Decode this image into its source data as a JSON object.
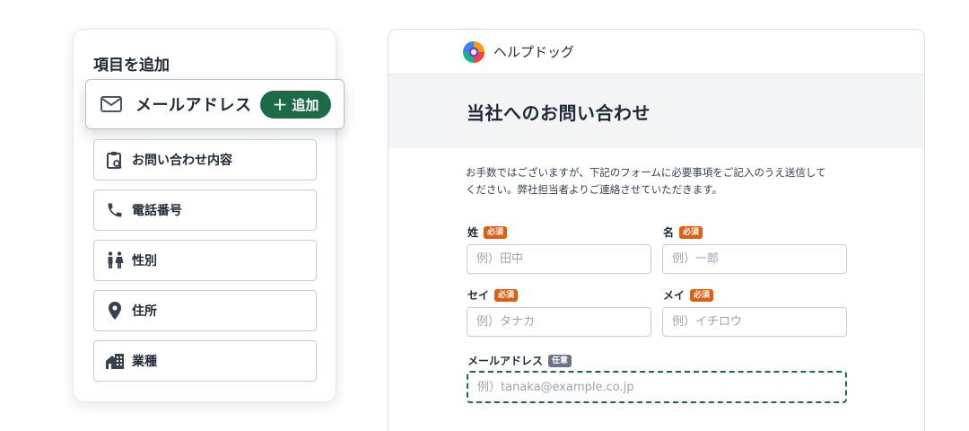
{
  "panel": {
    "title": "項目を追加",
    "drag_card": {
      "label": "メールアドレス",
      "icon": "mail-icon"
    },
    "add_button": {
      "label": "追加",
      "color": "#1b6b49"
    },
    "items": [
      {
        "label": "お問い合わせ内容",
        "icon": "clipboard-search-icon"
      },
      {
        "label": "電話番号",
        "icon": "phone-icon"
      },
      {
        "label": "性別",
        "icon": "gender-icon"
      },
      {
        "label": "住所",
        "icon": "location-pin-icon"
      },
      {
        "label": "業種",
        "icon": "building-icon"
      }
    ]
  },
  "form": {
    "brand": "ヘルプドッグ",
    "title": "当社へのお問い合わせ",
    "intro_line1": "お手数ではございますが、下記のフォームに必要事項をご記入のうえ送信して",
    "intro_line2": "ください。弊社担当者よりご連絡させていただきます。",
    "required_badge": "必須",
    "optional_badge": "任意",
    "fields": {
      "last_name": {
        "label": "姓",
        "placeholder": "例）田中"
      },
      "first_name": {
        "label": "名",
        "placeholder": "例）一郎"
      },
      "last_name_kana": {
        "label": "セイ",
        "placeholder": "例）タナカ"
      },
      "first_name_kana": {
        "label": "メイ",
        "placeholder": "例）イチロウ"
      },
      "email": {
        "label": "メールアドレス",
        "placeholder": "例）tanaka@example.co.jp"
      }
    },
    "colors": {
      "required": "#e05d12",
      "optional": "#6b7280",
      "accent": "#1b6b49"
    }
  }
}
